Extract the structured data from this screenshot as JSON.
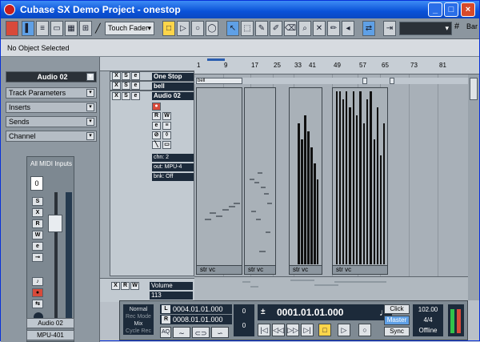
{
  "window": {
    "title": "Cubase SX Demo Project - onestop",
    "minimize": "_",
    "maximize": "□",
    "close": "×"
  },
  "toolbar": {
    "automation_mode": "Touch Fader",
    "grid_value": "Bar",
    "tools": [
      "object-selection-tool",
      "range-tool",
      "split-tool",
      "glue-tool",
      "erase-tool",
      "zoom-tool",
      "mute-tool",
      "draw-tool",
      "play-tool"
    ]
  },
  "info_line": {
    "text": "No Object Selected"
  },
  "inspector": {
    "track_name": "Audio 02",
    "sections": [
      "Track Parameters",
      "Inserts",
      "Sends",
      "Channel"
    ],
    "channel": {
      "input": "All MIDI Inputs",
      "channel_number": "0",
      "volume": "113",
      "name": "Audio 02",
      "output": "MPU-401"
    }
  },
  "tracks": [
    {
      "name": "One Stop"
    },
    {
      "name": "bell"
    },
    {
      "name": "Audio 02",
      "chn": "chn: 2",
      "out": "out: MPU-4",
      "bnk": "bnk: Off"
    }
  ],
  "automation_track": {
    "name": "Volume",
    "value": "113"
  },
  "ruler": {
    "ticks": [
      "1",
      "9",
      "17",
      "25",
      "33",
      "41",
      "49",
      "57",
      "65",
      "73",
      "81"
    ],
    "markers": [
      "L",
      "R"
    ]
  },
  "events": {
    "bell_label": "bell",
    "parts": [
      "str vc",
      "str vc",
      "str vc",
      "str vc"
    ]
  },
  "transport": {
    "mode_normal": "Normal",
    "mode_rec": "Rec Mode",
    "mode_mix": "Mix",
    "mode_cycle": "Cycle Rec",
    "left_locator": "0004.01.01.000",
    "right_locator": "0008.01.01.000",
    "locator_l": "L",
    "locator_r": "R",
    "quantize": "AQ",
    "pre_roll": "0",
    "post_roll": "0",
    "position": "0001.01.01.000",
    "click": "Click",
    "master": "Master",
    "sync": "Sync",
    "tempo": "102.00",
    "signature": "4/4",
    "offline": "Offline"
  }
}
